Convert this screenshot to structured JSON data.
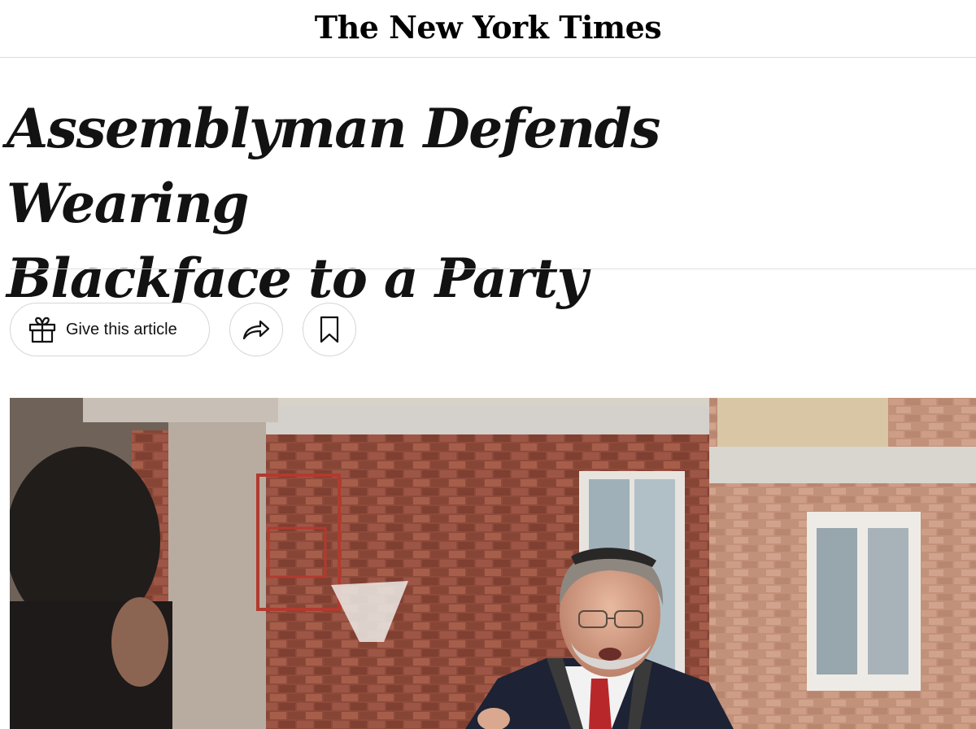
{
  "masthead": {
    "logo": "The New York Times"
  },
  "article": {
    "headline_line1": "Assemblyman Defends Wearing",
    "headline_line2": "Blackface to a Party"
  },
  "toolbar": {
    "gift_label": "Give this article",
    "gift_icon": "gift-icon",
    "share_icon": "share-icon",
    "save_icon": "bookmark-icon"
  },
  "photo": {
    "icon": "lead-photo"
  }
}
